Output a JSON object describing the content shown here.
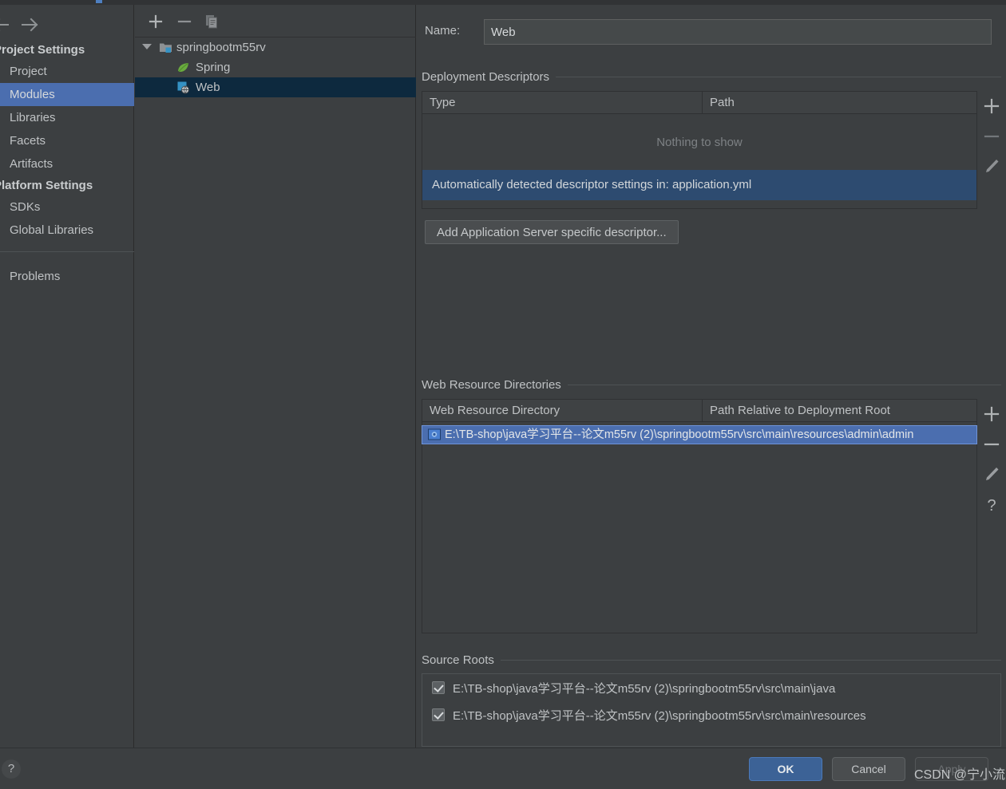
{
  "navigation": {
    "back_icon": "arrow-left-icon",
    "forward_icon": "arrow-right-icon"
  },
  "sidebar": {
    "groups": [
      {
        "title": "Project Settings",
        "items": [
          {
            "label": "Project",
            "selected": false
          },
          {
            "label": "Modules",
            "selected": true
          },
          {
            "label": "Libraries",
            "selected": false
          },
          {
            "label": "Facets",
            "selected": false
          },
          {
            "label": "Artifacts",
            "selected": false
          }
        ]
      },
      {
        "title": "Platform Settings",
        "items": [
          {
            "label": "SDKs",
            "selected": false
          },
          {
            "label": "Global Libraries",
            "selected": false
          }
        ]
      }
    ],
    "problems_label": "Problems"
  },
  "module_tree": {
    "toolbar": [
      {
        "name": "add-module-button",
        "icon": "plus-icon"
      },
      {
        "name": "remove-module-button",
        "icon": "minus-icon"
      },
      {
        "name": "copy-module-button",
        "icon": "copy-icon"
      }
    ],
    "nodes": [
      {
        "label": "springbootm55rv",
        "icon": "module-folder-icon",
        "indent": 26,
        "expanded": true,
        "selected": false
      },
      {
        "label": "Spring",
        "icon": "spring-leaf-icon",
        "indent": 52,
        "expanded": false,
        "selected": false
      },
      {
        "label": "Web",
        "icon": "web-facet-icon",
        "indent": 52,
        "expanded": false,
        "selected": true
      }
    ]
  },
  "detail": {
    "name_label": "Name:",
    "name_value": "Web",
    "name_placeholder": "Name",
    "deployment_descriptors": {
      "title": "Deployment Descriptors",
      "columns": [
        "Type",
        "Path"
      ],
      "empty_text": "Nothing to show",
      "rows": [],
      "banner_text": "Automatically detected descriptor settings in: application.yml",
      "add_button_label": "Add Application Server specific descriptor...",
      "toolbar": [
        {
          "name": "add-descriptor-button",
          "icon": "plus-icon"
        },
        {
          "name": "remove-descriptor-button",
          "icon": "minus-icon"
        },
        {
          "name": "edit-descriptor-button",
          "icon": "pencil-icon"
        }
      ]
    },
    "web_resource_directories": {
      "title": "Web Resource Directories",
      "columns": [
        "Web Resource Directory",
        "Path Relative to Deployment Root"
      ],
      "rows": [
        {
          "directory": "E:\\TB-shop\\java学习平台--论文m55rv (2)\\springbootm55rv\\src\\main\\resources\\admin\\admin",
          "relative_path": "",
          "icon": "web-resource-folder-icon",
          "selected": true
        }
      ],
      "toolbar": [
        {
          "name": "add-web-resource-button",
          "icon": "plus-icon"
        },
        {
          "name": "remove-web-resource-button",
          "icon": "minus-icon"
        },
        {
          "name": "edit-web-resource-button",
          "icon": "pencil-icon"
        },
        {
          "name": "web-resource-help-button",
          "icon": "question-mark-icon"
        }
      ]
    },
    "source_roots": {
      "title": "Source Roots",
      "rows": [
        {
          "label": "E:\\TB-shop\\java学习平台--论文m55rv (2)\\springbootm55rv\\src\\main\\java",
          "checked": true
        },
        {
          "label": "E:\\TB-shop\\java学习平台--论文m55rv (2)\\springbootm55rv\\src\\main\\resources",
          "checked": true
        }
      ]
    }
  },
  "footer": {
    "help_icon": "question-mark-icon",
    "ok_label": "OK",
    "cancel_label": "Cancel",
    "apply_label": "Apply"
  },
  "watermark": "CSDN @宁小流",
  "colors": {
    "background": "#3c3f41",
    "sidebar_selection": "#4b6eaf",
    "tree_selection": "#0d293e",
    "banner": "#2d4b70",
    "ok_button": "#3c6296",
    "spring_green": "#6aab3f",
    "web_icon_blue": "#3592c4"
  }
}
